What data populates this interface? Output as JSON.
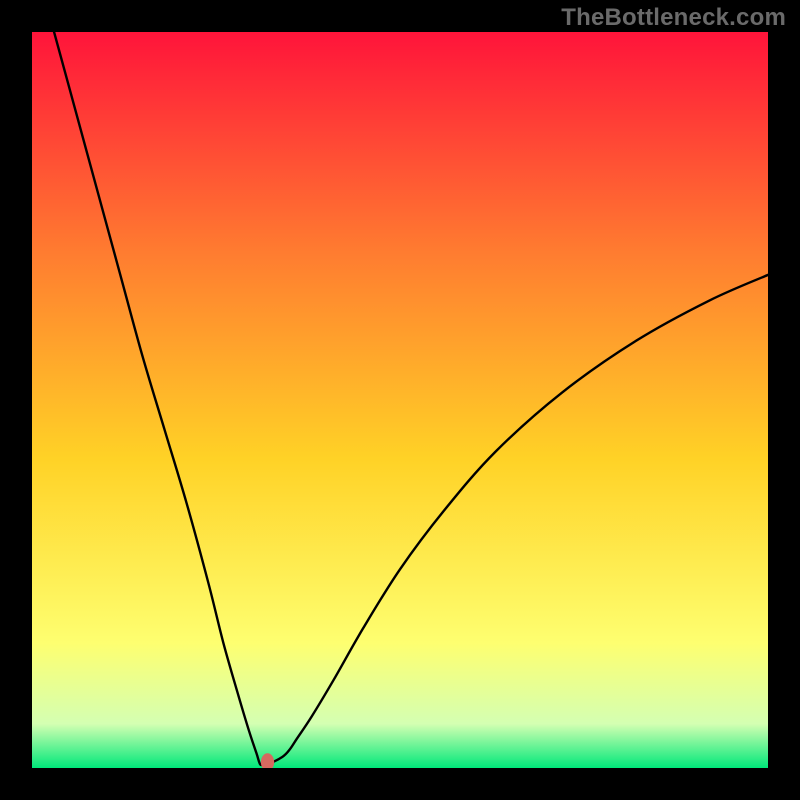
{
  "watermark": "TheBottleneck.com",
  "chart_data": {
    "type": "line",
    "title": "",
    "xlabel": "",
    "ylabel": "",
    "xlim": [
      0,
      100
    ],
    "ylim": [
      0,
      100
    ],
    "grid": false,
    "legend": false,
    "background_gradient": {
      "top_color": "#ff143a",
      "mid_upper_color": "#ff7c30",
      "mid_color": "#ffd226",
      "mid_lower_color": "#feff70",
      "near_bottom_color": "#d4ffb2",
      "bottom_color": "#00e87a"
    },
    "series": [
      {
        "name": "bottleneck-curve",
        "color": "#000000",
        "x": [
          3,
          6,
          9,
          12,
          15,
          18,
          21,
          24,
          26,
          28,
          29.5,
          30.5,
          31,
          31.5,
          32,
          34,
          35,
          36,
          38,
          41,
          45,
          50,
          56,
          63,
          72,
          82,
          92,
          100
        ],
        "y": [
          100,
          89,
          78,
          67,
          56,
          46,
          36,
          25,
          17,
          10,
          5,
          2,
          0.5,
          0.5,
          0.5,
          1.5,
          2.5,
          4,
          7,
          12,
          19,
          27,
          35,
          43,
          51,
          58,
          63.5,
          67
        ]
      }
    ],
    "marker": {
      "name": "current-point",
      "color": "#d46a5f",
      "x": 32,
      "y": 0.8,
      "rx": 0.9,
      "ry": 1.2
    }
  }
}
